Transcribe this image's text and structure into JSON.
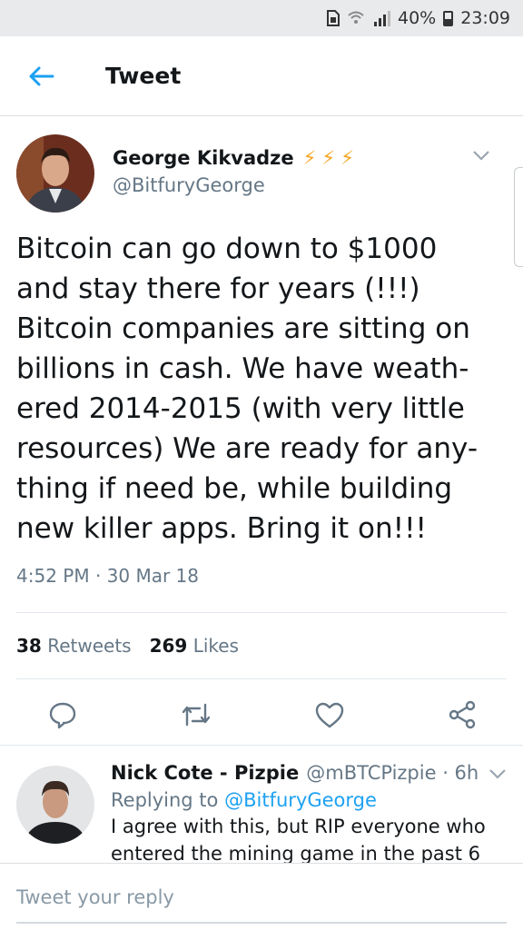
{
  "status_bar": {
    "battery_percent": "40%",
    "time": "23:09"
  },
  "header": {
    "title": "Tweet",
    "back_icon": "arrow-left-icon"
  },
  "tweet": {
    "display_name": "George Kikvadze",
    "badges": "⚡⚡⚡",
    "handle": "@BitfuryGeorge",
    "text": "Bitcoin can go down to $1000\nand stay there for years (!!!)\nBitcoin companies are sitting on\nbillions in cash. We have weath-\nered 2014-2015 (with very little\nresources) We are ready for any-\nthing if need be, while building\nnew killer apps. Bring it on!!!",
    "timestamp": "4:52 PM · 30 Mar 18",
    "retweets_count": "38",
    "retweets_label": "Retweets",
    "likes_count": "269",
    "likes_label": "Likes"
  },
  "actions": [
    "reply-icon",
    "retweet-icon",
    "like-icon",
    "share-icon"
  ],
  "reply": {
    "display_name": "Nick Cote - Pizpie",
    "handle_time": "@mBTCPizpie · 6h",
    "replying_prefix": "Replying to",
    "replying_to": "@BitfuryGeorge",
    "text": "I agree with this, but RIP everyone who entered the mining game in the past 6"
  },
  "compose": {
    "placeholder": "Tweet your reply"
  },
  "colors": {
    "accent": "#1da1f2",
    "secondary_text": "#657786",
    "bolt": "#f5a623"
  }
}
